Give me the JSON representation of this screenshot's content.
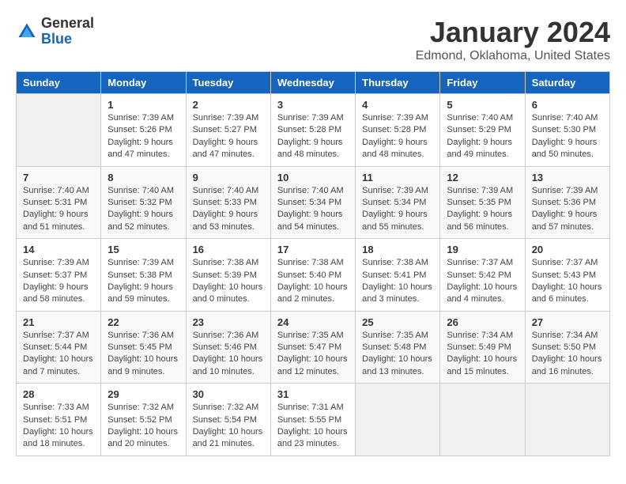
{
  "header": {
    "logo_general": "General",
    "logo_blue": "Blue",
    "title": "January 2024",
    "subtitle": "Edmond, Oklahoma, United States"
  },
  "days_of_week": [
    "Sunday",
    "Monday",
    "Tuesday",
    "Wednesday",
    "Thursday",
    "Friday",
    "Saturday"
  ],
  "weeks": [
    [
      {
        "day": "",
        "empty": true
      },
      {
        "day": "1",
        "sunrise": "7:39 AM",
        "sunset": "5:26 PM",
        "daylight": "9 hours and 47 minutes."
      },
      {
        "day": "2",
        "sunrise": "7:39 AM",
        "sunset": "5:27 PM",
        "daylight": "9 hours and 47 minutes."
      },
      {
        "day": "3",
        "sunrise": "7:39 AM",
        "sunset": "5:28 PM",
        "daylight": "9 hours and 48 minutes."
      },
      {
        "day": "4",
        "sunrise": "7:39 AM",
        "sunset": "5:28 PM",
        "daylight": "9 hours and 48 minutes."
      },
      {
        "day": "5",
        "sunrise": "7:40 AM",
        "sunset": "5:29 PM",
        "daylight": "9 hours and 49 minutes."
      },
      {
        "day": "6",
        "sunrise": "7:40 AM",
        "sunset": "5:30 PM",
        "daylight": "9 hours and 50 minutes."
      }
    ],
    [
      {
        "day": "7",
        "sunrise": "7:40 AM",
        "sunset": "5:31 PM",
        "daylight": "9 hours and 51 minutes."
      },
      {
        "day": "8",
        "sunrise": "7:40 AM",
        "sunset": "5:32 PM",
        "daylight": "9 hours and 52 minutes."
      },
      {
        "day": "9",
        "sunrise": "7:40 AM",
        "sunset": "5:33 PM",
        "daylight": "9 hours and 53 minutes."
      },
      {
        "day": "10",
        "sunrise": "7:40 AM",
        "sunset": "5:34 PM",
        "daylight": "9 hours and 54 minutes."
      },
      {
        "day": "11",
        "sunrise": "7:39 AM",
        "sunset": "5:34 PM",
        "daylight": "9 hours and 55 minutes."
      },
      {
        "day": "12",
        "sunrise": "7:39 AM",
        "sunset": "5:35 PM",
        "daylight": "9 hours and 56 minutes."
      },
      {
        "day": "13",
        "sunrise": "7:39 AM",
        "sunset": "5:36 PM",
        "daylight": "9 hours and 57 minutes."
      }
    ],
    [
      {
        "day": "14",
        "sunrise": "7:39 AM",
        "sunset": "5:37 PM",
        "daylight": "9 hours and 58 minutes."
      },
      {
        "day": "15",
        "sunrise": "7:39 AM",
        "sunset": "5:38 PM",
        "daylight": "9 hours and 59 minutes."
      },
      {
        "day": "16",
        "sunrise": "7:38 AM",
        "sunset": "5:39 PM",
        "daylight": "10 hours and 0 minutes."
      },
      {
        "day": "17",
        "sunrise": "7:38 AM",
        "sunset": "5:40 PM",
        "daylight": "10 hours and 2 minutes."
      },
      {
        "day": "18",
        "sunrise": "7:38 AM",
        "sunset": "5:41 PM",
        "daylight": "10 hours and 3 minutes."
      },
      {
        "day": "19",
        "sunrise": "7:37 AM",
        "sunset": "5:42 PM",
        "daylight": "10 hours and 4 minutes."
      },
      {
        "day": "20",
        "sunrise": "7:37 AM",
        "sunset": "5:43 PM",
        "daylight": "10 hours and 6 minutes."
      }
    ],
    [
      {
        "day": "21",
        "sunrise": "7:37 AM",
        "sunset": "5:44 PM",
        "daylight": "10 hours and 7 minutes."
      },
      {
        "day": "22",
        "sunrise": "7:36 AM",
        "sunset": "5:45 PM",
        "daylight": "10 hours and 9 minutes."
      },
      {
        "day": "23",
        "sunrise": "7:36 AM",
        "sunset": "5:46 PM",
        "daylight": "10 hours and 10 minutes."
      },
      {
        "day": "24",
        "sunrise": "7:35 AM",
        "sunset": "5:47 PM",
        "daylight": "10 hours and 12 minutes."
      },
      {
        "day": "25",
        "sunrise": "7:35 AM",
        "sunset": "5:48 PM",
        "daylight": "10 hours and 13 minutes."
      },
      {
        "day": "26",
        "sunrise": "7:34 AM",
        "sunset": "5:49 PM",
        "daylight": "10 hours and 15 minutes."
      },
      {
        "day": "27",
        "sunrise": "7:34 AM",
        "sunset": "5:50 PM",
        "daylight": "10 hours and 16 minutes."
      }
    ],
    [
      {
        "day": "28",
        "sunrise": "7:33 AM",
        "sunset": "5:51 PM",
        "daylight": "10 hours and 18 minutes."
      },
      {
        "day": "29",
        "sunrise": "7:32 AM",
        "sunset": "5:52 PM",
        "daylight": "10 hours and 20 minutes."
      },
      {
        "day": "30",
        "sunrise": "7:32 AM",
        "sunset": "5:54 PM",
        "daylight": "10 hours and 21 minutes."
      },
      {
        "day": "31",
        "sunrise": "7:31 AM",
        "sunset": "5:55 PM",
        "daylight": "10 hours and 23 minutes."
      },
      {
        "day": "",
        "empty": true
      },
      {
        "day": "",
        "empty": true
      },
      {
        "day": "",
        "empty": true
      }
    ]
  ],
  "labels": {
    "sunrise": "Sunrise:",
    "sunset": "Sunset:",
    "daylight": "Daylight:"
  }
}
